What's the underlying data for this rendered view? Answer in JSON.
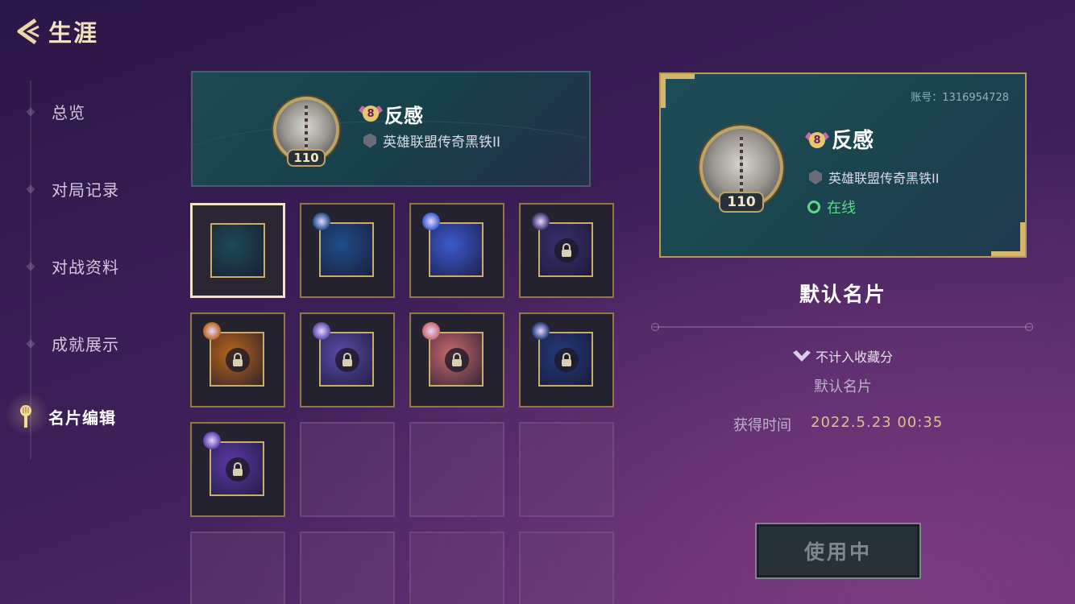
{
  "header": {
    "title": "生涯",
    "back_icon": "back-arrow-icon"
  },
  "sidebar": {
    "items": [
      {
        "label": "总览"
      },
      {
        "label": "对局记录"
      },
      {
        "label": "对战资料"
      },
      {
        "label": "成就展示"
      },
      {
        "label": "名片编辑",
        "active": true,
        "icon": "spoon-marker-icon"
      }
    ]
  },
  "preview": {
    "player_name": "反感",
    "level": "110",
    "badge_number": "8",
    "rank_text": "英雄联盟传奇黑铁II"
  },
  "cards_grid": {
    "tiles": [
      {
        "state": "selected",
        "theme": "#1d4a55"
      },
      {
        "state": "unlocked",
        "theme": "#1f4d8a"
      },
      {
        "state": "unlocked",
        "theme": "#3a5ad0"
      },
      {
        "state": "locked",
        "theme": "#3b2f6e"
      },
      {
        "state": "locked",
        "theme": "#b8661a"
      },
      {
        "state": "locked",
        "theme": "#5a4aa8"
      },
      {
        "state": "locked",
        "theme": "#c76a6a"
      },
      {
        "state": "locked",
        "theme": "#223a7a"
      },
      {
        "state": "locked",
        "theme": "#5b3aa8"
      },
      {
        "state": "empty"
      },
      {
        "state": "empty"
      },
      {
        "state": "empty"
      },
      {
        "state": "empty"
      },
      {
        "state": "empty"
      },
      {
        "state": "empty"
      },
      {
        "state": "empty"
      }
    ]
  },
  "detail": {
    "account": "账号：1316954728",
    "player_name": "反感",
    "level": "110",
    "badge_number": "8",
    "rank_text": "英雄联盟传奇黑铁II",
    "status": "在线",
    "card_name": "默认名片",
    "collection_note": "不计入收藏分",
    "description": "默认名片",
    "obtain_label": "获得时间",
    "obtain_time": "2022.5.23   00:35",
    "button_label": "使用中"
  },
  "colors": {
    "accent_gold": "#bda365",
    "online_green": "#5dd889"
  }
}
